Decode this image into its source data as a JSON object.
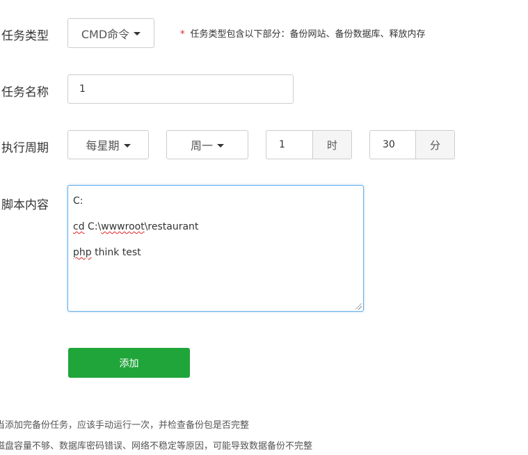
{
  "form": {
    "task_type": {
      "label": "任务类型",
      "selected": "CMD命令",
      "hint_marker": "*",
      "hint": "任务类型包含以下部分：备份网站、备份数据库、释放内存"
    },
    "task_name": {
      "label": "任务名称",
      "value": "1"
    },
    "schedule": {
      "label": "执行周期",
      "period": "每星期",
      "weekday": "周一",
      "hour_value": "1",
      "hour_unit": "时",
      "minute_value": "30",
      "minute_unit": "分"
    },
    "script": {
      "label": "脚本内容",
      "lines": [
        {
          "pre": "",
          "misspelled": "",
          "post": "C:"
        },
        {
          "pre": "",
          "misspelled": "cd",
          "post": " C:\\"
        },
        {
          "pre": "",
          "misspelled": "php",
          "post": " think test"
        }
      ],
      "line2_path_misspelled": "wwwroot",
      "line2_path_rest": "\\restaurant"
    },
    "submit_label": "添加"
  },
  "notes": [
    "当添加完备份任务，应该手动运行一次，并检查备份包是否完整",
    "磁盘容量不够、数据库密码错误、网络不稳定等原因，可能导致数据备份不完整"
  ],
  "colors": {
    "primary_button": "#20a53a",
    "required_marker": "#e02020",
    "focus_border": "#66afe9"
  }
}
